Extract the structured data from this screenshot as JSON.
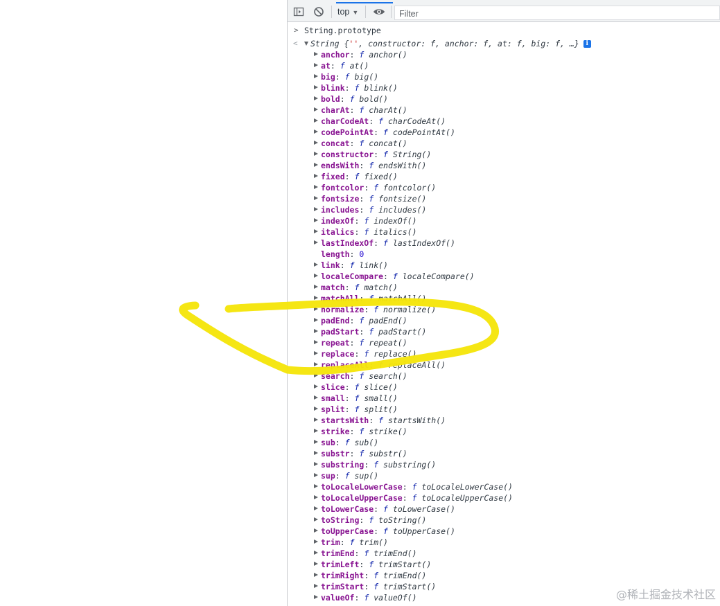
{
  "toolbar": {
    "context_label": "top",
    "filter_placeholder": "Filter"
  },
  "console": {
    "input_prompt": ">",
    "input_text": "String.prototype",
    "result_arrow": "<",
    "summary_prefix": "String {",
    "summary_string": "''",
    "summary_rest": ", constructor: f, anchor: f, at: f, big: f, …}",
    "info_badge": "i",
    "properties": [
      {
        "key": "anchor",
        "value": "anchor()",
        "type": "fn"
      },
      {
        "key": "at",
        "value": "at()",
        "type": "fn"
      },
      {
        "key": "big",
        "value": "big()",
        "type": "fn"
      },
      {
        "key": "blink",
        "value": "blink()",
        "type": "fn"
      },
      {
        "key": "bold",
        "value": "bold()",
        "type": "fn"
      },
      {
        "key": "charAt",
        "value": "charAt()",
        "type": "fn"
      },
      {
        "key": "charCodeAt",
        "value": "charCodeAt()",
        "type": "fn"
      },
      {
        "key": "codePointAt",
        "value": "codePointAt()",
        "type": "fn"
      },
      {
        "key": "concat",
        "value": "concat()",
        "type": "fn"
      },
      {
        "key": "constructor",
        "value": "String()",
        "type": "fn"
      },
      {
        "key": "endsWith",
        "value": "endsWith()",
        "type": "fn"
      },
      {
        "key": "fixed",
        "value": "fixed()",
        "type": "fn"
      },
      {
        "key": "fontcolor",
        "value": "fontcolor()",
        "type": "fn"
      },
      {
        "key": "fontsize",
        "value": "fontsize()",
        "type": "fn"
      },
      {
        "key": "includes",
        "value": "includes()",
        "type": "fn"
      },
      {
        "key": "indexOf",
        "value": "indexOf()",
        "type": "fn"
      },
      {
        "key": "italics",
        "value": "italics()",
        "type": "fn"
      },
      {
        "key": "lastIndexOf",
        "value": "lastIndexOf()",
        "type": "fn"
      },
      {
        "key": "length",
        "value": "0",
        "type": "num"
      },
      {
        "key": "link",
        "value": "link()",
        "type": "fn"
      },
      {
        "key": "localeCompare",
        "value": "localeCompare()",
        "type": "fn"
      },
      {
        "key": "match",
        "value": "match()",
        "type": "fn"
      },
      {
        "key": "matchAll",
        "value": "matchAll()",
        "type": "fn"
      },
      {
        "key": "normalize",
        "value": "normalize()",
        "type": "fn"
      },
      {
        "key": "padEnd",
        "value": "padEnd()",
        "type": "fn"
      },
      {
        "key": "padStart",
        "value": "padStart()",
        "type": "fn"
      },
      {
        "key": "repeat",
        "value": "repeat()",
        "type": "fn"
      },
      {
        "key": "replace",
        "value": "replace()",
        "type": "fn"
      },
      {
        "key": "replaceAll",
        "value": "replaceAll()",
        "type": "fn"
      },
      {
        "key": "search",
        "value": "search()",
        "type": "fn"
      },
      {
        "key": "slice",
        "value": "slice()",
        "type": "fn"
      },
      {
        "key": "small",
        "value": "small()",
        "type": "fn"
      },
      {
        "key": "split",
        "value": "split()",
        "type": "fn"
      },
      {
        "key": "startsWith",
        "value": "startsWith()",
        "type": "fn"
      },
      {
        "key": "strike",
        "value": "strike()",
        "type": "fn"
      },
      {
        "key": "sub",
        "value": "sub()",
        "type": "fn"
      },
      {
        "key": "substr",
        "value": "substr()",
        "type": "fn"
      },
      {
        "key": "substring",
        "value": "substring()",
        "type": "fn"
      },
      {
        "key": "sup",
        "value": "sup()",
        "type": "fn"
      },
      {
        "key": "toLocaleLowerCase",
        "value": "toLocaleLowerCase()",
        "type": "fn"
      },
      {
        "key": "toLocaleUpperCase",
        "value": "toLocaleUpperCase()",
        "type": "fn"
      },
      {
        "key": "toLowerCase",
        "value": "toLowerCase()",
        "type": "fn"
      },
      {
        "key": "toString",
        "value": "toString()",
        "type": "fn"
      },
      {
        "key": "toUpperCase",
        "value": "toUpperCase()",
        "type": "fn"
      },
      {
        "key": "trim",
        "value": "trim()",
        "type": "fn"
      },
      {
        "key": "trimEnd",
        "value": "trimEnd()",
        "type": "fn"
      },
      {
        "key": "trimLeft",
        "value": "trimStart()",
        "type": "fn"
      },
      {
        "key": "trimRight",
        "value": "trimEnd()",
        "type": "fn"
      },
      {
        "key": "trimStart",
        "value": "trimStart()",
        "type": "fn"
      },
      {
        "key": "valueOf",
        "value": "valueOf()",
        "type": "fn"
      }
    ]
  },
  "watermark": "@稀土掘金技术社区",
  "colors": {
    "key": "#881391",
    "fn_marker": "#0d22aa",
    "number": "#1c00cf",
    "string": "#c41a16",
    "highlight": "#f5e50a",
    "accent": "#1a73e8"
  },
  "icons": [
    "sidebar-toggle-icon",
    "clear-console-icon",
    "eye-icon",
    "info-icon"
  ]
}
